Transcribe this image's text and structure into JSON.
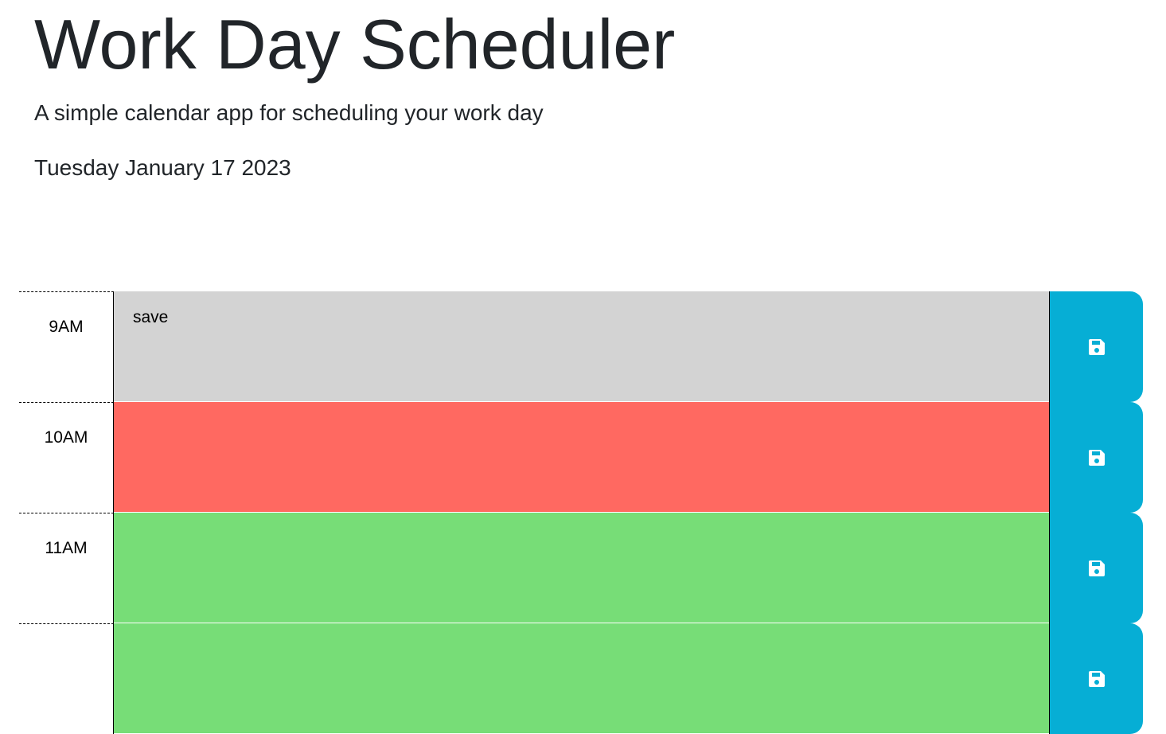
{
  "header": {
    "title": "Work Day Scheduler",
    "subtitle": "A simple calendar app for scheduling your work day",
    "current_date": "Tuesday January 17 2023"
  },
  "colors": {
    "past": "#d3d3d3",
    "present": "#ff6961",
    "future": "#77dd77",
    "save_button": "#06aed5"
  },
  "time_blocks": [
    {
      "hour": "9AM",
      "status": "past",
      "text": "save",
      "save_icon": "floppy-disk-icon"
    },
    {
      "hour": "10AM",
      "status": "present",
      "text": "",
      "save_icon": "floppy-disk-icon"
    },
    {
      "hour": "11AM",
      "status": "future",
      "text": "",
      "save_icon": "floppy-disk-icon"
    },
    {
      "hour": "",
      "status": "future",
      "text": "",
      "save_icon": "floppy-disk-icon"
    }
  ]
}
